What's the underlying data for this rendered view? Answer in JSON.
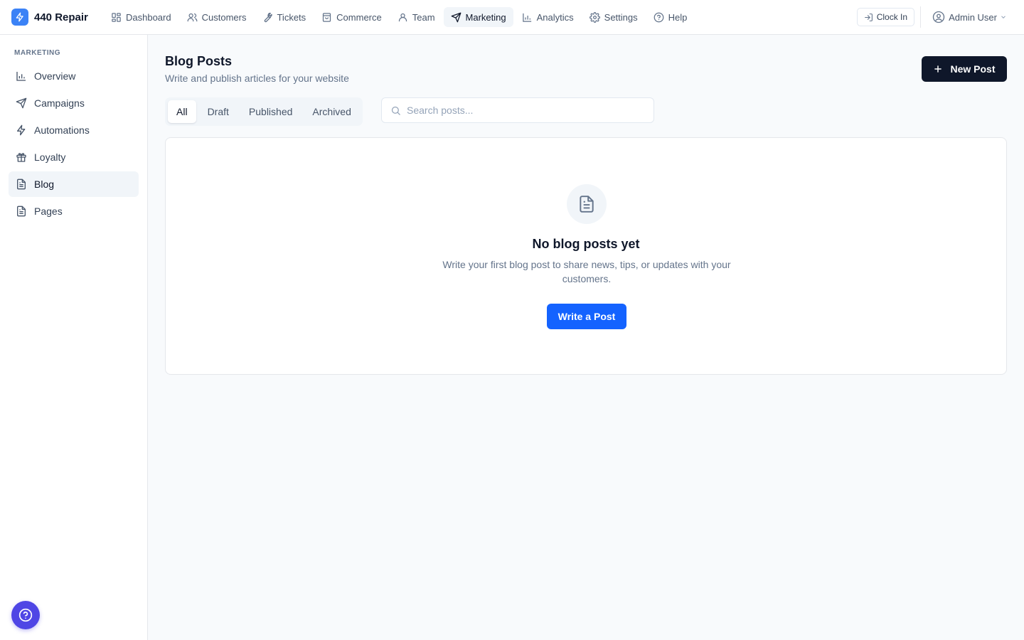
{
  "app": {
    "name": "440 Repair",
    "logo_icon": "bolt-icon",
    "accent": "#3b82f6"
  },
  "topnav": {
    "items": [
      {
        "label": "Dashboard",
        "icon": "grid-icon"
      },
      {
        "label": "Customers",
        "icon": "users-icon"
      },
      {
        "label": "Tickets",
        "icon": "wrench-icon"
      },
      {
        "label": "Commerce",
        "icon": "shopping-bag-icon"
      },
      {
        "label": "Team",
        "icon": "user-icon"
      },
      {
        "label": "Marketing",
        "icon": "send-icon",
        "active": true
      },
      {
        "label": "Analytics",
        "icon": "bar-chart-icon"
      },
      {
        "label": "Settings",
        "icon": "gear-icon"
      },
      {
        "label": "Help",
        "icon": "help-circle-icon"
      }
    ],
    "clock_in_label": "Clock In",
    "user_name": "Admin User"
  },
  "sidebar": {
    "heading": "MARKETING",
    "items": [
      {
        "label": "Overview",
        "icon": "bar-chart-icon"
      },
      {
        "label": "Campaigns",
        "icon": "send-icon"
      },
      {
        "label": "Automations",
        "icon": "bolt-icon"
      },
      {
        "label": "Loyalty",
        "icon": "gift-icon"
      },
      {
        "label": "Blog",
        "icon": "document-icon",
        "active": true
      },
      {
        "label": "Pages",
        "icon": "document-icon"
      }
    ]
  },
  "main": {
    "title": "Blog Posts",
    "subtitle": "Write and publish articles for your website",
    "new_post_label": "New Post",
    "tabs": [
      {
        "label": "All",
        "active": true
      },
      {
        "label": "Draft"
      },
      {
        "label": "Published"
      },
      {
        "label": "Archived"
      }
    ],
    "search": {
      "placeholder": "Search posts...",
      "value": ""
    },
    "empty_state": {
      "title": "No blog posts yet",
      "text": "Write your first blog post to share news, tips, or updates with your customers.",
      "button_label": "Write a Post"
    }
  },
  "colors": {
    "primary_dark": "#0f172a",
    "primary_blue": "#1463ff",
    "help_fab": "#4f46e5"
  }
}
